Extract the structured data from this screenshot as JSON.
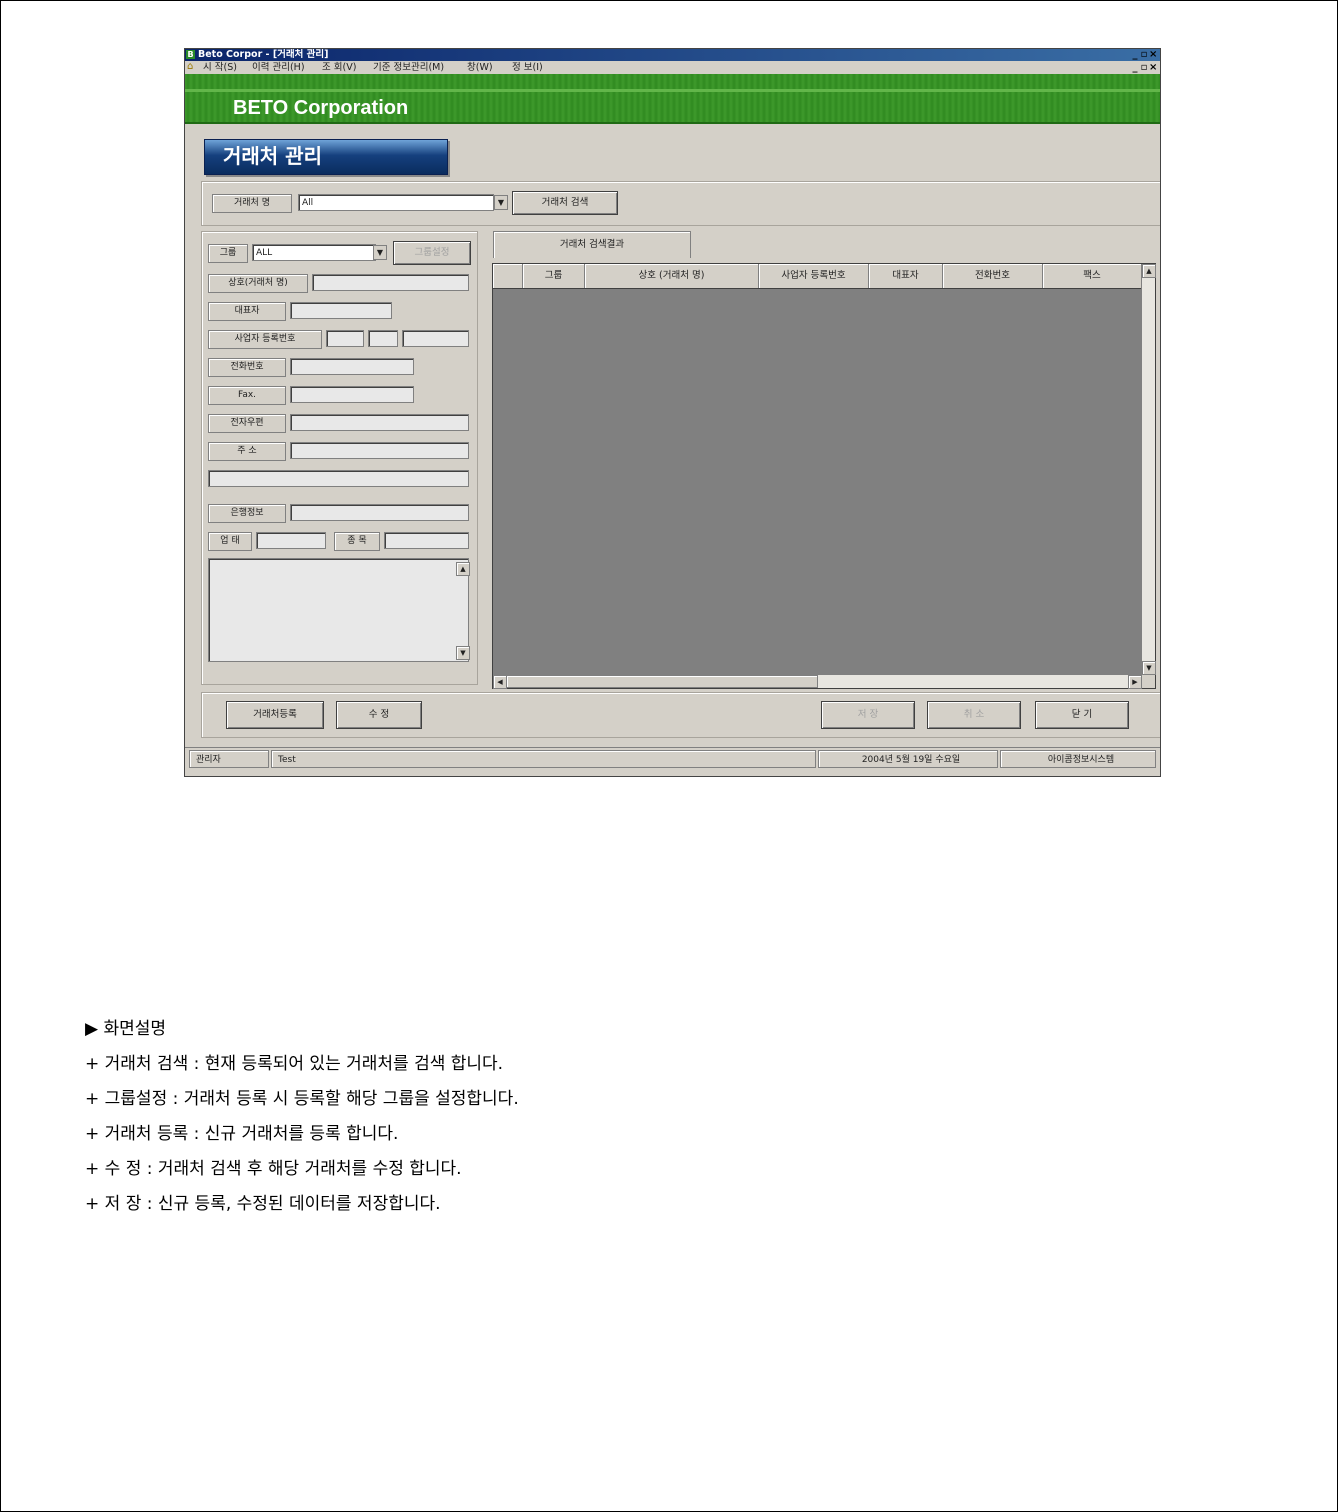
{
  "window": {
    "title": "Beto Corpor - [거래처 관리]",
    "controls": [
      "_",
      "▫",
      "×"
    ]
  },
  "menu": [
    "시 작(S)",
    "이력 관리(H)",
    "조 회(V)",
    "기준 정보관리(M)",
    "창(W)",
    "정 보(I)"
  ],
  "banner": {
    "corporation": "BETO Corporation"
  },
  "page_title": "거래처 관리",
  "search": {
    "label": "거래처 명",
    "value": "All",
    "button": "거래처 검색"
  },
  "form": {
    "group_label": "그룹",
    "group_value": "ALL",
    "group_button": "그룹설정",
    "company_label": "상호(거래처 명)",
    "ceo_label": "대표자",
    "bizno_label": "사업자 등록번호",
    "phone_label": "전화번호",
    "fax_label": "Fax.",
    "email_label": "전자우편",
    "address_label": "주 소",
    "bank_label": "은행정보",
    "biztype_label": "업 태",
    "bizitem_label": "종 목"
  },
  "results": {
    "tab": "거래처 검색결과",
    "columns": [
      "그룹",
      "상호 (거래처 명)",
      "사업자 등록번호",
      "대표자",
      "전화번호",
      "팩스"
    ]
  },
  "actions": {
    "register": "거래처등록",
    "edit": "수 정",
    "save": "저 장",
    "cancel": "취 소",
    "close": "닫 기"
  },
  "status": {
    "role": "관리자",
    "user": "Test",
    "date": "2004년 5월 19일 수요일",
    "system": "아이콤정보시스템"
  },
  "description": {
    "heading": "▶ 화면설명",
    "items": [
      "+ 거래처 검색 : 현재 등록되어 있는 거래처를 검색 합니다.",
      "+ 그룹설정 : 거래처 등록 시 등록할 해당 그룹을 설정합니다.",
      "+ 거래처 등록 : 신규 거래처를 등록 합니다.",
      "+ 수 정 : 거래처 검색 후 해당 거래처를 수정 합니다.",
      "+ 저 장 : 신규 등록, 수정된 데이터를 저장합니다."
    ]
  }
}
